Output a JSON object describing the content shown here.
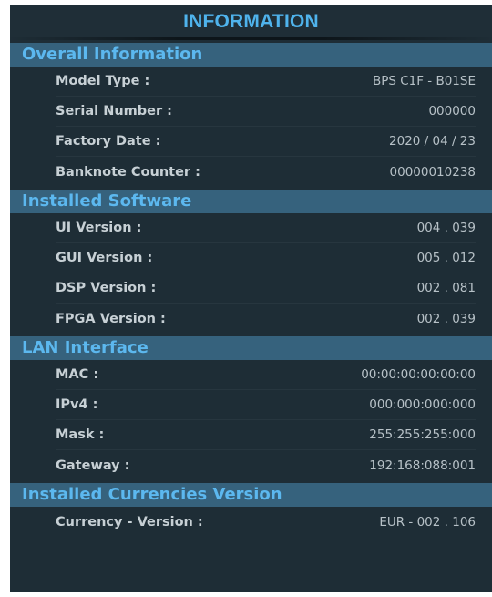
{
  "title": "INFORMATION",
  "colors": {
    "panel_bg": "#1e2d36",
    "section_header_bg": "#36627d",
    "accent_text": "#4fb3ec"
  },
  "sections": [
    {
      "header": "Overall Information",
      "rows": [
        {
          "label": "Model Type :",
          "value": "BPS C1F - B01SE"
        },
        {
          "label": "Serial Number :",
          "value": "000000"
        },
        {
          "label": "Factory Date :",
          "value": "2020 / 04 / 23"
        },
        {
          "label": "Banknote Counter :",
          "value": "00000010238"
        }
      ]
    },
    {
      "header": "Installed Software",
      "rows": [
        {
          "label": "UI Version :",
          "value": "004 . 039"
        },
        {
          "label": "GUI Version :",
          "value": "005 . 012"
        },
        {
          "label": "DSP Version :",
          "value": "002 . 081"
        },
        {
          "label": "FPGA Version :",
          "value": "002 . 039"
        }
      ]
    },
    {
      "header": "LAN Interface",
      "rows": [
        {
          "label": "MAC :",
          "value": "00:00:00:00:00:00"
        },
        {
          "label": "IPv4 :",
          "value": "000:000:000:000"
        },
        {
          "label": "Mask :",
          "value": "255:255:255:000"
        },
        {
          "label": "Gateway :",
          "value": "192:168:088:001"
        }
      ]
    },
    {
      "header": "Installed Currencies Version",
      "rows": [
        {
          "label": "Currency - Version :",
          "value": "EUR - 002 . 106"
        }
      ]
    }
  ]
}
